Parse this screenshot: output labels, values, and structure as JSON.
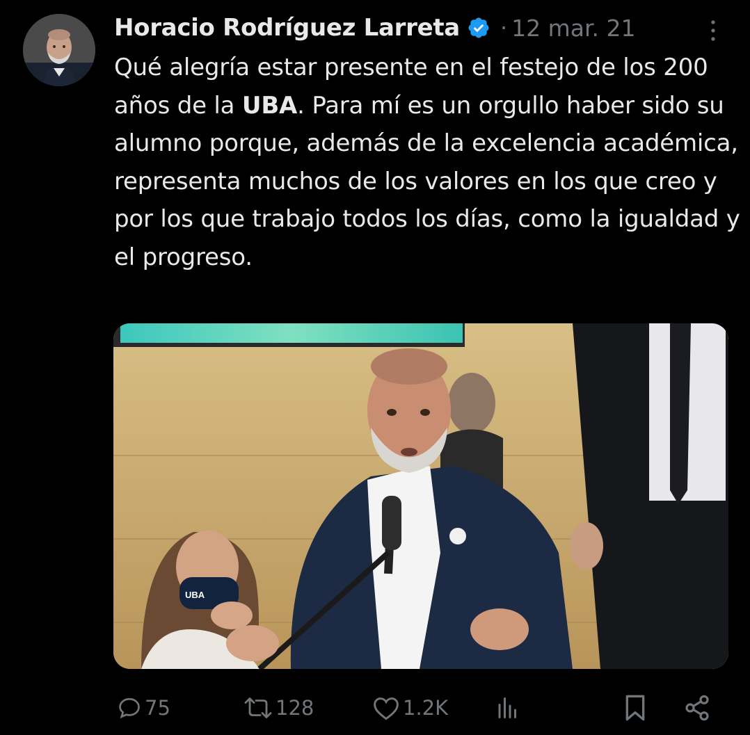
{
  "author": {
    "display_name": "Horacio Rodríguez Larreta",
    "verified": true,
    "separator": "·",
    "timestamp": "12 mar. 21"
  },
  "tweet": {
    "text_before_bold": "Qué alegría estar presente en el festejo de los 200 años de la ",
    "text_bold": "UBA",
    "text_after_bold": ". Para mí es un orgullo haber sido su alumno porque, además de la excelencia académica, representa muchos de los valores en los que creo y por los que trabajo todos los días, como la igualdad y el progreso."
  },
  "media": {
    "mask_text": "UBA"
  },
  "actions": {
    "reply_count": "75",
    "retweet_count": "128",
    "like_count": "1.2K"
  },
  "icons": {
    "verified": "verified-badge-icon",
    "more": "more-vertical-icon",
    "reply": "reply-icon",
    "retweet": "retweet-icon",
    "like": "heart-icon",
    "views": "views-icon",
    "bookmark": "bookmark-icon",
    "share": "share-icon"
  },
  "colors": {
    "background": "#000000",
    "text": "#e7e9ea",
    "muted": "#71767b",
    "verified_blue": "#1d9bf0"
  }
}
